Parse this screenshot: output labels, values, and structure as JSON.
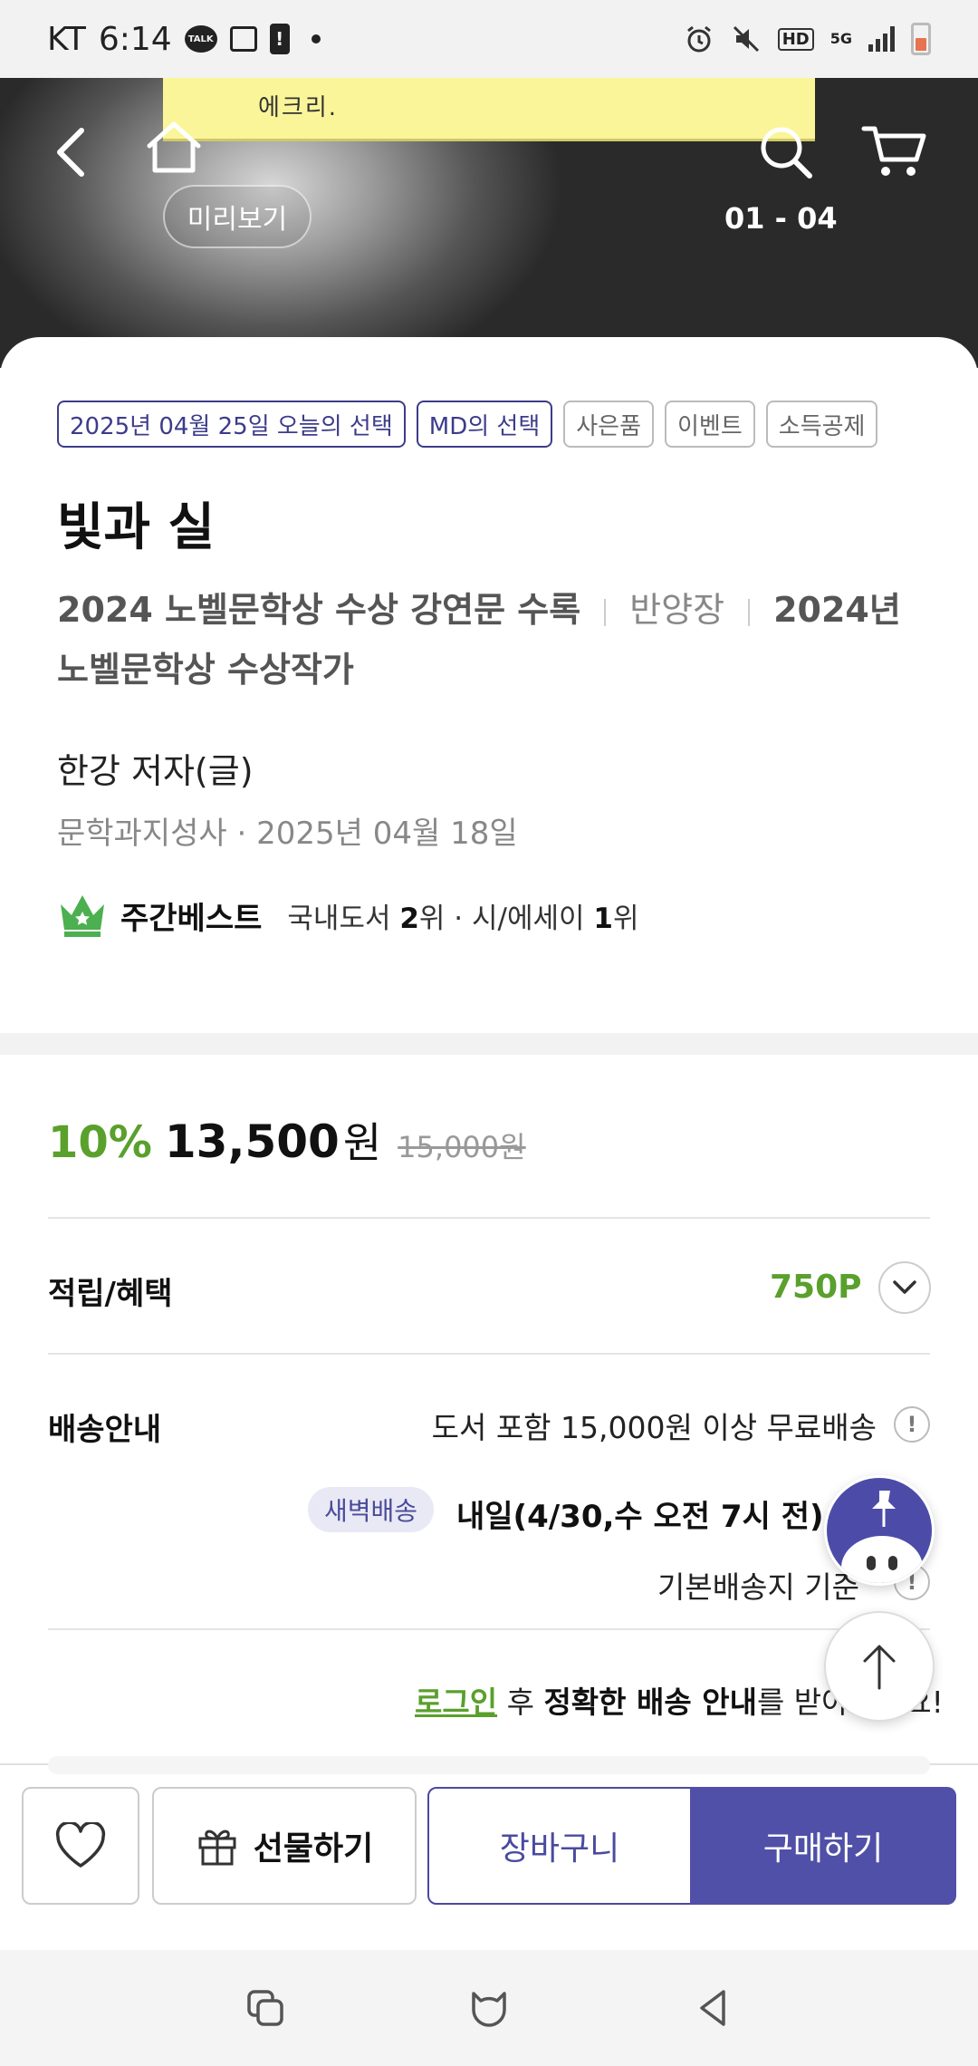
{
  "status_bar": {
    "carrier": "KT",
    "time": "6:14",
    "talk_label": "TALK",
    "hd_label": "HD",
    "network_label": "5G"
  },
  "header": {
    "sticky_note": "에크리.",
    "preview_label": "미리보기",
    "page_indicator": "01 - 04"
  },
  "badges": [
    {
      "label": "2025년 04월 25일 오늘의 선택",
      "style": "primary"
    },
    {
      "label": "MD의 선택",
      "style": "primary"
    },
    {
      "label": "사은품",
      "style": "secondary"
    },
    {
      "label": "이벤트",
      "style": "secondary"
    },
    {
      "label": "소득공제",
      "style": "secondary"
    }
  ],
  "book": {
    "title": "빛과 실",
    "subtitle_1": "2024 노벨문학상 수상 강연문 수록",
    "subtitle_2": "반양장",
    "subtitle_3": "2024년 노벨문학상 수상작가",
    "author": "한강 저자(글)",
    "publisher_date": "문학과지성사 · 2025년 04월 18일"
  },
  "bestseller": {
    "label": "주간베스트",
    "category_1": "국내도서 ",
    "rank_1": "2",
    "rank_suffix_1": "위 · 시/에세이 ",
    "rank_2": "1",
    "rank_suffix_2": "위"
  },
  "price": {
    "discount": "10%",
    "sale_price": "13,500",
    "unit": "원",
    "original_price": "15,000원"
  },
  "benefits": {
    "label": "적립/혜택",
    "points": "750P"
  },
  "shipping": {
    "label": "배송안내",
    "free_shipping": "도서 포함 15,000원 이상 무료배송",
    "dawn_badge": "새벽배송",
    "dawn_text": "내일(4/30,수 오전 7시 전) 도",
    "base_address": "기본배송지 기준",
    "login_link": "로그인",
    "login_after": " 후 ",
    "login_bold": "정확한 배송 안내",
    "login_rest": "를 받아보세요!"
  },
  "actions": {
    "gift": "선물하기",
    "add_cart": "장바구니",
    "buy": "구매하기"
  },
  "colors": {
    "accent_green": "#5aa02c",
    "primary_purple": "#5050a8"
  }
}
